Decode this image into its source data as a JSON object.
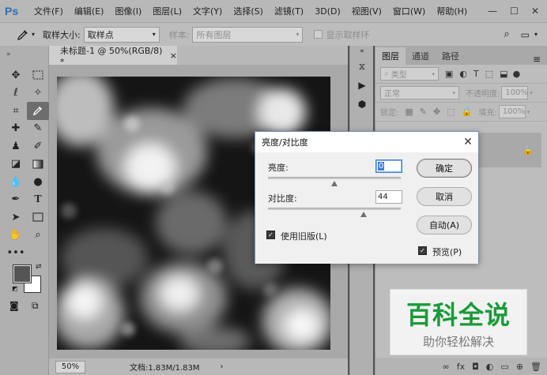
{
  "app": {
    "logo": "Ps",
    "menus": [
      "文件(F)",
      "编辑(E)",
      "图像(I)",
      "图层(L)",
      "文字(Y)",
      "选择(S)",
      "滤镜(T)",
      "3D(D)",
      "视图(V)",
      "窗口(W)",
      "帮助(H)"
    ],
    "window_controls": [
      "—",
      "☐",
      "✕"
    ]
  },
  "options_bar": {
    "sample_size_label": "取样大小:",
    "sample_size_value": "取样点",
    "sample_label": "样本:",
    "sample_value": "所有图层",
    "show_ring_label": "显示取样环"
  },
  "document": {
    "tab_title": "未标题-1 @ 50%(RGB/8) *",
    "tab_close": "×",
    "zoom": "50%",
    "doc_info": "文档:1.83M/1.83M",
    "status_arrow": "›"
  },
  "layers_panel": {
    "tabs": [
      "图层",
      "通道",
      "路径"
    ],
    "menu_icon": "≡",
    "kind_label": "类型",
    "blend_mode": "正常",
    "opacity_label": "不透明度:",
    "opacity_value": "100%",
    "lock_label": "锁定:",
    "fill_label": "填充:",
    "fill_value": "100%",
    "bottom_icons": [
      "∞",
      "fx",
      "◘",
      "◐",
      "▭",
      "⊕",
      "🗑"
    ]
  },
  "watermark": {
    "title": "百科全说",
    "subtitle": "助你轻松解决"
  },
  "dialog": {
    "title": "亮度/对比度",
    "close": "✕",
    "brightness_label": "亮度:",
    "brightness_value": "0",
    "contrast_label": "对比度:",
    "contrast_value": "44",
    "brightness_slider": 0.5,
    "contrast_slider": 0.72,
    "use_legacy_label": "使用旧版(L)",
    "use_legacy_checked": true,
    "ok_label": "确定",
    "cancel_label": "取消",
    "auto_label": "自动(A)",
    "preview_label": "预览(P)",
    "preview_checked": true
  },
  "colors": {
    "accent": "#3b7fd4",
    "watermark_green": "#1a9a3a"
  }
}
